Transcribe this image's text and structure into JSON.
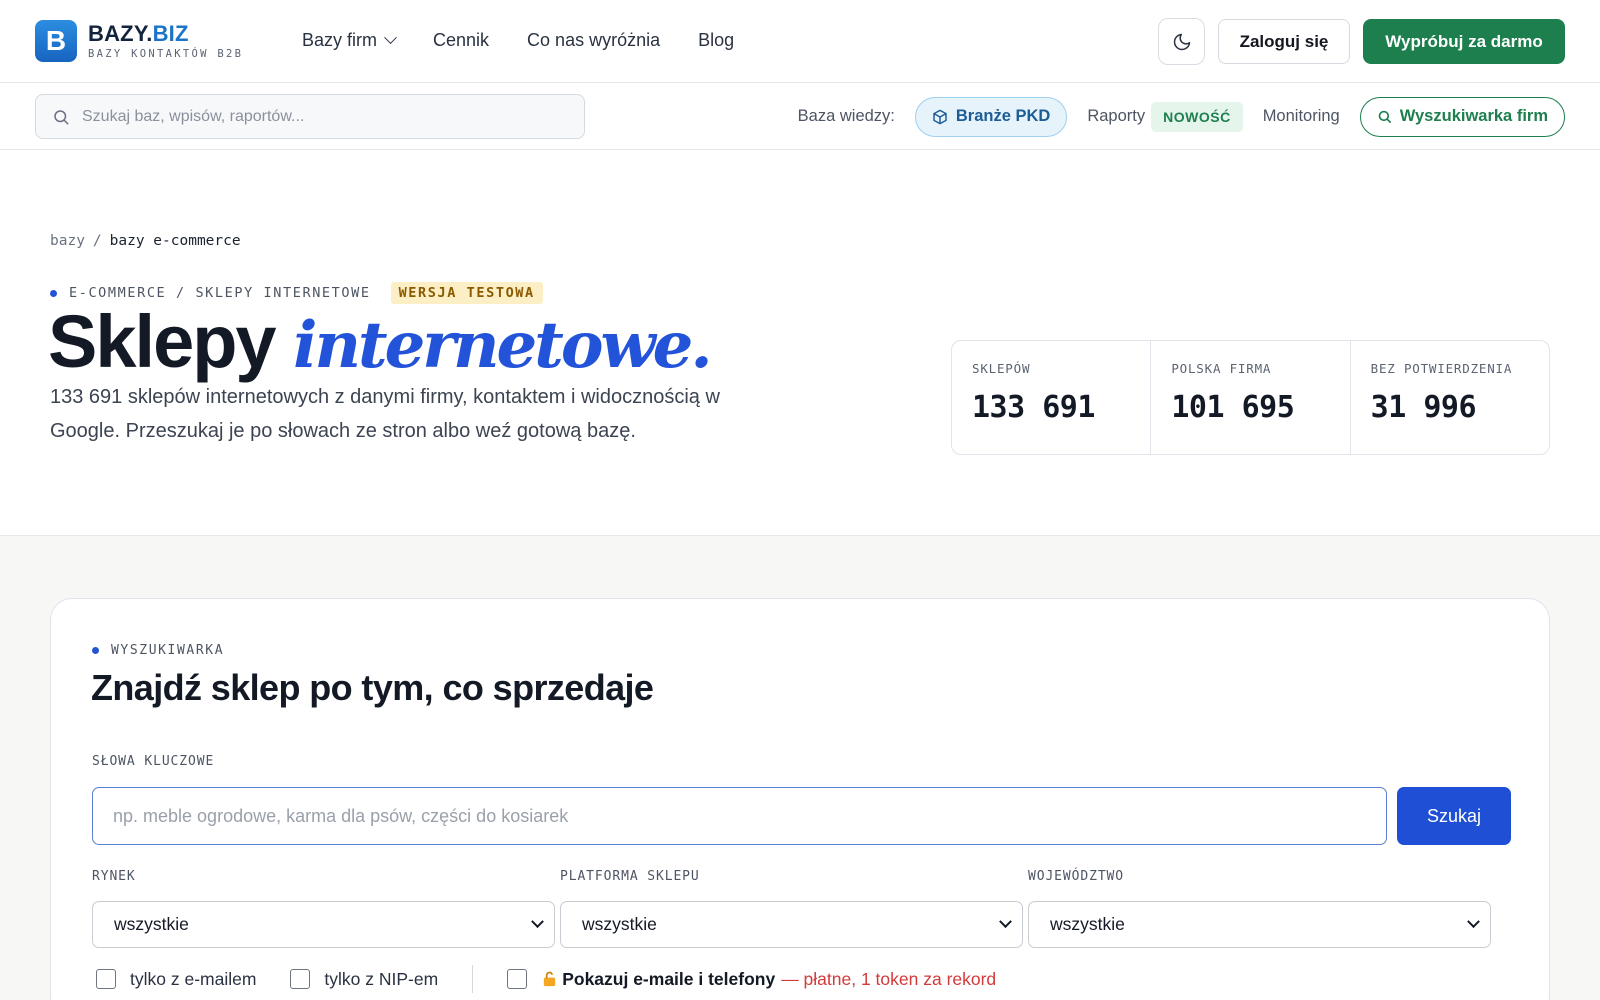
{
  "brand": {
    "mark": "B",
    "name_dark": "BAZY.",
    "name_blue": "BIZ",
    "tagline": "BAZY KONTAKTÓW B2B"
  },
  "nav": {
    "items": [
      {
        "label": "Bazy firm",
        "has_dropdown": true
      },
      {
        "label": "Cennik"
      },
      {
        "label": "Co nas wyróżnia"
      },
      {
        "label": "Blog"
      }
    ],
    "theme_icon": "moon-icon",
    "login": "Zaloguj się",
    "cta": "Wypróbuj za darmo"
  },
  "subnav": {
    "search_placeholder": "Szukaj baz, wpisów, raportów...",
    "kb_label": "Baza wiedzy:",
    "pkd": "Branże PKD",
    "reports": "Raporty",
    "new_badge": "NOWOŚĆ",
    "monitoring": "Monitoring",
    "finder": "Wyszukiwarka firm"
  },
  "breadcrumb": {
    "root": "bazy",
    "sep": "/",
    "current": "bazy e-commerce"
  },
  "hero": {
    "eyebrow": "E-COMMERCE / SKLEPY INTERNETOWE",
    "test_badge": "WERSJA TESTOWA",
    "title_plain": "Sklepy",
    "title_accent": "internetowe.",
    "description": "133 691 sklepów internetowych z danymi firmy, kontaktem i widocznością w Google. Przeszukaj je po słowach ze stron albo weź gotową bazę."
  },
  "stats": [
    {
      "label": "SKLEPÓW",
      "value": "133 691"
    },
    {
      "label": "POLSKA FIRMA",
      "value": "101 695"
    },
    {
      "label": "BEZ POTWIERDZENIA",
      "value": "31 996"
    }
  ],
  "finder": {
    "eyebrow": "WYSZUKIWARKA",
    "title": "Znajdź sklep po tym, co sprzedaje",
    "keywords_label": "SŁOWA KLUCZOWE",
    "keywords_placeholder": "np. meble ogrodowe, karma dla psów, części do kosiarek",
    "search_button": "Szukaj",
    "filters": [
      {
        "label": "RYNEK",
        "value": "wszystkie"
      },
      {
        "label": "PLATFORMA SKLEPU",
        "value": "wszystkie"
      },
      {
        "label": "WOJEWÓDZTWO",
        "value": "wszystkie"
      }
    ],
    "checkboxes": {
      "email_only": "tylko z e-mailem",
      "nip_only": "tylko z NIP-em",
      "show_contacts": "Pokazuj e-maile i telefony",
      "paid_note": "— płatne, 1 token za rekord"
    }
  },
  "colors": {
    "accent_blue": "#2353d8",
    "brand_green": "#1d7f4e",
    "warning_red": "#d23b3b"
  }
}
